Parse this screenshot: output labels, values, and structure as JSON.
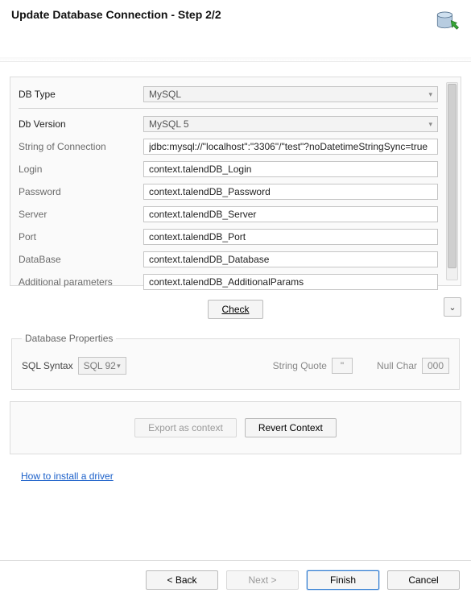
{
  "title": "Update Database Connection - Step 2/2",
  "main": {
    "dbTypeLabel": "DB Type",
    "dbTypeValue": "MySQL",
    "dbVersionLabel": "Db Version",
    "dbVersionValue": "MySQL 5",
    "connStrLabel": "String of Connection",
    "connStrValue": "jdbc:mysql://\"localhost\":\"3306\"/\"test\"?noDatetimeStringSync=true",
    "loginLabel": "Login",
    "loginValue": "context.talendDB_Login",
    "passwordLabel": "Password",
    "passwordValue": "context.talendDB_Password",
    "serverLabel": "Server",
    "serverValue": "context.talendDB_Server",
    "portLabel": "Port",
    "portValue": "context.talendDB_Port",
    "databaseLabel": "DataBase",
    "databaseValue": "context.talendDB_Database",
    "addlParamsLabel": "Additional parameters",
    "addlParamsValue": "context.talendDB_AdditionalParams"
  },
  "checkButton": "Check",
  "dbProps": {
    "legend": "Database Properties",
    "sqlSyntaxLabel": "SQL Syntax",
    "sqlSyntaxValue": "SQL 92",
    "stringQuoteLabel": "String Quote",
    "stringQuoteValue": "\"",
    "nullCharLabel": "Null Char",
    "nullCharValue": "000"
  },
  "contextBox": {
    "exportLabel": "Export as context",
    "revertLabel": "Revert Context"
  },
  "helpLink": "How to install a driver",
  "footer": {
    "back": "< Back",
    "next": "Next >",
    "finish": "Finish",
    "cancel": "Cancel"
  }
}
